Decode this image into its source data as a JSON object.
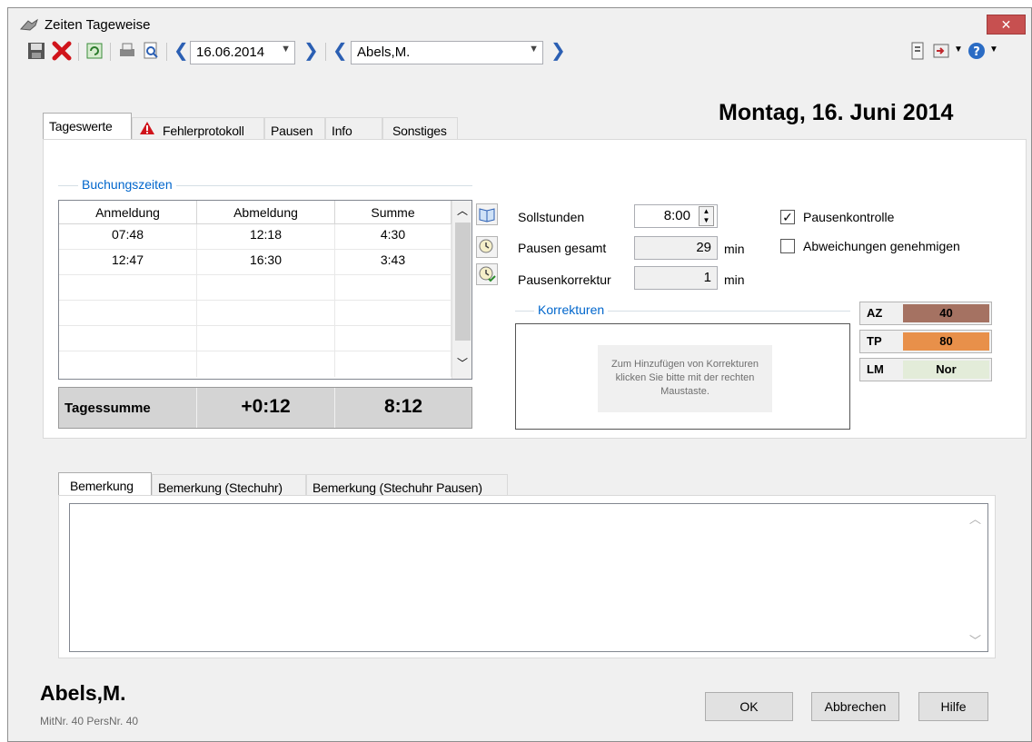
{
  "window": {
    "title": "Zeiten Tageweise",
    "close_glyph": "✕"
  },
  "toolbar": {
    "date": "16.06.2014",
    "employee": "Abels,M.",
    "icons": [
      "save-icon",
      "delete-icon",
      "refresh-icon",
      "print-icon",
      "print-preview-icon",
      "prev-date-icon",
      "next-date-icon",
      "prev-employee-icon",
      "next-employee-icon",
      "report-icon",
      "export-icon",
      "help-icon"
    ]
  },
  "header": {
    "date_title": "Montag, 16. Juni 2014"
  },
  "tabs": [
    "Tageswerte",
    "Fehlerprotokoll",
    "Pausen",
    "Info",
    "Sonstiges"
  ],
  "booking": {
    "group_title": "Buchungszeiten",
    "columns": [
      "Anmeldung",
      "Abmeldung",
      "Summe"
    ],
    "rows": [
      [
        "07:48",
        "12:18",
        "4:30"
      ],
      [
        "12:47",
        "16:30",
        "3:43"
      ],
      [
        "",
        "",
        ""
      ],
      [
        "",
        "",
        ""
      ],
      [
        "",
        "",
        ""
      ],
      [
        "",
        "",
        ""
      ]
    ],
    "totals": {
      "label": "Tagessumme",
      "diff": "+0:12",
      "sum": "8:12"
    }
  },
  "fields": {
    "soll_label": "Sollstunden",
    "soll_value": "8:00",
    "pausen_label": "Pausen gesamt",
    "pausen_value": "29",
    "pausen_unit": "min",
    "korr_label": "Pausenkorrektur",
    "korr_value": "1",
    "korr_unit": "min"
  },
  "checks": {
    "pausenkontrolle": {
      "label": "Pausenkontrolle",
      "checked": true
    },
    "abweichungen": {
      "label": "Abweichungen genehmigen",
      "checked": false
    }
  },
  "korrekturen": {
    "group_title": "Korrekturen",
    "hint": "Zum Hinzufügen von Korrekturen klicken Sie bitte mit der rechten Maustaste."
  },
  "status": [
    {
      "key": "AZ",
      "value": "40",
      "color": "#a57262"
    },
    {
      "key": "TP",
      "value": "80",
      "color": "#e8904a"
    },
    {
      "key": "LM",
      "value": "Nor",
      "color": "#e3ecd9"
    }
  ],
  "notes_tabs": [
    "Bemerkung",
    "Bemerkung (Stechuhr)",
    "Bemerkung (Stechuhr Pausen)"
  ],
  "footer": {
    "employee_name": "Abels,M.",
    "employee_sub": "MitNr. 40   PersNr. 40",
    "ok": "OK",
    "cancel": "Abbrechen",
    "help": "Hilfe"
  }
}
